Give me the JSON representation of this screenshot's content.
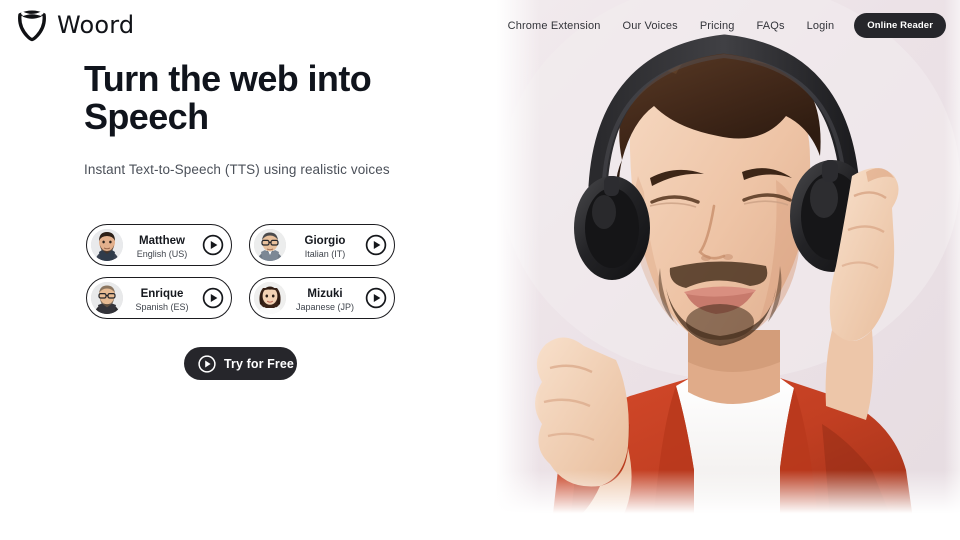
{
  "brand": {
    "name": "Woord",
    "logo_icon": "shield-logo-icon"
  },
  "nav": {
    "links": [
      {
        "label": "Chrome Extension",
        "name": "nav-link-chrome-extension"
      },
      {
        "label": "Our Voices",
        "name": "nav-link-our-voices"
      },
      {
        "label": "Pricing",
        "name": "nav-link-pricing"
      },
      {
        "label": "FAQs",
        "name": "nav-link-faqs"
      },
      {
        "label": "Login",
        "name": "nav-link-login"
      }
    ],
    "cta": {
      "label": "Online Reader",
      "background": "#26262b",
      "color": "#ffffff"
    }
  },
  "hero": {
    "headline_line1": "Turn the web into",
    "headline_line2": "Speech",
    "subhead": "Instant Text-to-Speech (TTS) using realistic voices",
    "headline_color": "#10141c",
    "subhead_color": "#4b5059",
    "cta": {
      "label": "Try for Free",
      "icon": "play-icon",
      "background": "#26262b"
    },
    "image": {
      "alt": "Man with closed eyes wearing black over-ear headphones, hands holding headphones, orange jacket over white t-shirt",
      "background_color": "#ece3e7"
    }
  },
  "voices": [
    {
      "name": "Matthew",
      "language": "English (US)",
      "avatar": "avatar-matthew",
      "play": "play-icon"
    },
    {
      "name": "Giorgio",
      "language": "Italian (IT)",
      "avatar": "avatar-giorgio",
      "play": "play-icon"
    },
    {
      "name": "Enrique",
      "language": "Spanish (ES)",
      "avatar": "avatar-enrique",
      "play": "play-icon"
    },
    {
      "name": "Mizuki",
      "language": "Japanese (JP)",
      "avatar": "avatar-mizuki",
      "play": "play-icon"
    }
  ]
}
